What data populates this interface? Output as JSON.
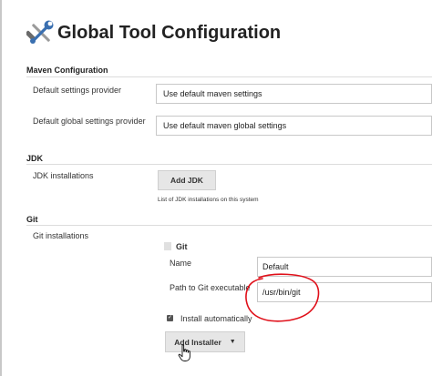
{
  "page": {
    "title": "Global Tool Configuration"
  },
  "maven": {
    "header": "Maven Configuration",
    "default_settings_label": "Default settings provider",
    "default_settings_value": "Use default maven settings",
    "global_settings_label": "Default global settings provider",
    "global_settings_value": "Use default maven global settings"
  },
  "jdk": {
    "header": "JDK",
    "installations_label": "JDK installations",
    "add_button": "Add JDK",
    "help_text": "List of JDK installations on this system"
  },
  "git": {
    "header": "Git",
    "installations_label": "Git installations",
    "item_title": "Git",
    "name_label": "Name",
    "name_value": "Default",
    "path_label": "Path to Git executable",
    "path_value": "/usr/bin/git",
    "install_auto_label": "Install automatically",
    "install_auto_checked": true,
    "add_installer_button": "Add Installer"
  },
  "colors": {
    "annotation": "#e0101a",
    "button_bg": "#e6e6e6",
    "border": "#c8c8c8"
  },
  "icons": [
    "tools-icon",
    "chevron-down-icon",
    "hand-cursor-icon",
    "check-icon"
  ]
}
